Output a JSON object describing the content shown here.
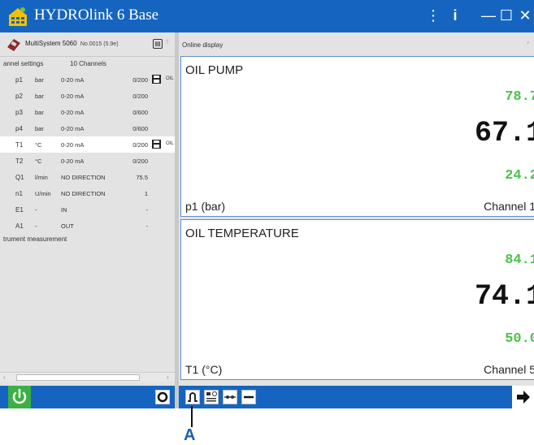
{
  "window": {
    "title": "HYDROlink 6 Base",
    "controls": {
      "more": "⋮",
      "info": "i",
      "minimize": "—",
      "maximize": "☐",
      "close": "✕"
    }
  },
  "device": {
    "name": "MultiSystem 5060",
    "serial": "No.0015 (5.9e)"
  },
  "channel_settings": {
    "heading": "annel settings",
    "count": "10 Channels",
    "rows": [
      {
        "name": "p1",
        "unit": "bar",
        "range": "0-20 mA",
        "value": "0/200",
        "tag": "OIL",
        "has_icon": true
      },
      {
        "name": "p2",
        "unit": "bar",
        "range": "0-20 mA",
        "value": "0/200",
        "tag": "",
        "has_icon": false
      },
      {
        "name": "p3",
        "unit": "bar",
        "range": "0-20 mA",
        "value": "0/600",
        "tag": "",
        "has_icon": false
      },
      {
        "name": "p4",
        "unit": "bar",
        "range": "0-20 mA",
        "value": "0/600",
        "tag": "",
        "has_icon": false
      },
      {
        "name": "T1",
        "unit": "°C",
        "range": "0-20 mA",
        "value": "0/200",
        "tag": "OIL",
        "has_icon": true
      },
      {
        "name": "T2",
        "unit": "°C",
        "range": "0-20 mA",
        "value": "0/200",
        "tag": "",
        "has_icon": false
      },
      {
        "name": "Q1",
        "unit": "l/min",
        "range": "NO DIRECTION",
        "value": "75.5",
        "tag": "",
        "has_icon": false
      },
      {
        "name": "n1",
        "unit": "U/min",
        "range": "NO DIRECTION",
        "value": "1",
        "tag": "",
        "has_icon": false
      },
      {
        "name": "E1",
        "unit": "-",
        "range": "IN",
        "value": "-",
        "tag": "",
        "has_icon": false
      },
      {
        "name": "A1",
        "unit": "-",
        "range": "OUT",
        "value": "-",
        "tag": "",
        "has_icon": false
      }
    ]
  },
  "instrument": {
    "heading": "trument measurement"
  },
  "online": {
    "title": "Online display",
    "cards": [
      {
        "title": "OIL PUMP",
        "max": "78.7",
        "current": "67.1",
        "min": "24.2",
        "measurement": "p1 (bar)",
        "channel": "Channel 1"
      },
      {
        "title": "OIL TEMPERATURE",
        "max": "84.1",
        "current": "74.1",
        "min": "50.0",
        "measurement": "T1 (°C)",
        "channel": "Channel 5"
      }
    ]
  },
  "toolbar": {
    "power_icon": "power-icon",
    "record_icon": "record-icon",
    "view_icons": [
      "curve-view-icon",
      "display-view-icon",
      "connection-view-icon",
      "minus-view-icon"
    ],
    "next_icon": "arrow-right-icon"
  },
  "annotation": {
    "label": "A"
  },
  "colors": {
    "brand": "#1565c0",
    "green": "#3cb043",
    "value_green": "#4cc24c",
    "card_border": "#5a8fd0"
  }
}
